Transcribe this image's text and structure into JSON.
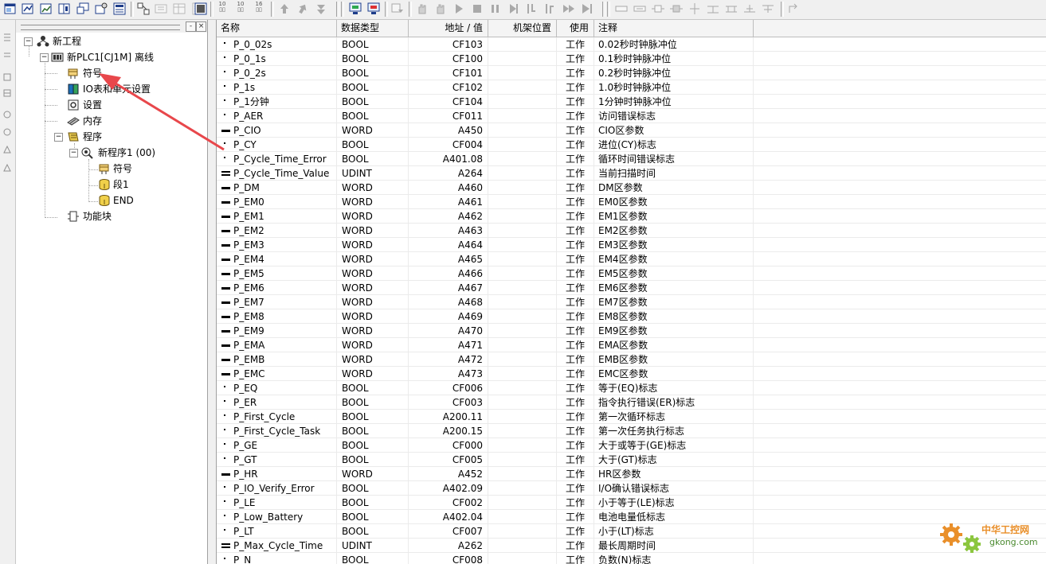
{
  "tree": {
    "root": "新工程",
    "plc": "新PLC1[CJ1M] 离线",
    "symbols": "符号",
    "io_table": "IO表和单元设置",
    "settings": "设置",
    "memory": "内存",
    "programs": "程序",
    "program1": "新程序1 (00)",
    "program_symbols": "符号",
    "section1": "段1",
    "end": "END",
    "function_blocks": "功能块"
  },
  "table": {
    "headers": {
      "name": "名称",
      "type": "数据类型",
      "address": "地址 / 值",
      "rack": "机架位置",
      "use": "使用",
      "comment": "注释"
    },
    "rows": [
      {
        "name": "P_0_02s",
        "type": "BOOL",
        "address": "CF103",
        "use": "工作",
        "comment": "0.02秒时钟脉冲位"
      },
      {
        "name": "P_0_1s",
        "type": "BOOL",
        "address": "CF100",
        "use": "工作",
        "comment": "0.1秒时钟脉冲位"
      },
      {
        "name": "P_0_2s",
        "type": "BOOL",
        "address": "CF101",
        "use": "工作",
        "comment": "0.2秒时钟脉冲位"
      },
      {
        "name": "P_1s",
        "type": "BOOL",
        "address": "CF102",
        "use": "工作",
        "comment": "1.0秒时钟脉冲位"
      },
      {
        "name": "P_1分钟",
        "type": "BOOL",
        "address": "CF104",
        "use": "工作",
        "comment": "1分钟时钟脉冲位"
      },
      {
        "name": "P_AER",
        "type": "BOOL",
        "address": "CF011",
        "use": "工作",
        "comment": "访问错误标志"
      },
      {
        "name": "P_CIO",
        "type": "WORD",
        "address": "A450",
        "use": "工作",
        "comment": "CIO区参数"
      },
      {
        "name": "P_CY",
        "type": "BOOL",
        "address": "CF004",
        "use": "工作",
        "comment": "进位(CY)标志"
      },
      {
        "name": "P_Cycle_Time_Error",
        "type": "BOOL",
        "address": "A401.08",
        "use": "工作",
        "comment": "循环时间错误标志"
      },
      {
        "name": "P_Cycle_Time_Value",
        "type": "UDINT",
        "address": "A264",
        "use": "工作",
        "comment": "当前扫描时间"
      },
      {
        "name": "P_DM",
        "type": "WORD",
        "address": "A460",
        "use": "工作",
        "comment": "DM区参数"
      },
      {
        "name": "P_EM0",
        "type": "WORD",
        "address": "A461",
        "use": "工作",
        "comment": "EM0区参数"
      },
      {
        "name": "P_EM1",
        "type": "WORD",
        "address": "A462",
        "use": "工作",
        "comment": "EM1区参数"
      },
      {
        "name": "P_EM2",
        "type": "WORD",
        "address": "A463",
        "use": "工作",
        "comment": "EM2区参数"
      },
      {
        "name": "P_EM3",
        "type": "WORD",
        "address": "A464",
        "use": "工作",
        "comment": "EM3区参数"
      },
      {
        "name": "P_EM4",
        "type": "WORD",
        "address": "A465",
        "use": "工作",
        "comment": "EM4区参数"
      },
      {
        "name": "P_EM5",
        "type": "WORD",
        "address": "A466",
        "use": "工作",
        "comment": "EM5区参数"
      },
      {
        "name": "P_EM6",
        "type": "WORD",
        "address": "A467",
        "use": "工作",
        "comment": "EM6区参数"
      },
      {
        "name": "P_EM7",
        "type": "WORD",
        "address": "A468",
        "use": "工作",
        "comment": "EM7区参数"
      },
      {
        "name": "P_EM8",
        "type": "WORD",
        "address": "A469",
        "use": "工作",
        "comment": "EM8区参数"
      },
      {
        "name": "P_EM9",
        "type": "WORD",
        "address": "A470",
        "use": "工作",
        "comment": "EM9区参数"
      },
      {
        "name": "P_EMA",
        "type": "WORD",
        "address": "A471",
        "use": "工作",
        "comment": "EMA区参数"
      },
      {
        "name": "P_EMB",
        "type": "WORD",
        "address": "A472",
        "use": "工作",
        "comment": "EMB区参数"
      },
      {
        "name": "P_EMC",
        "type": "WORD",
        "address": "A473",
        "use": "工作",
        "comment": "EMC区参数"
      },
      {
        "name": "P_EQ",
        "type": "BOOL",
        "address": "CF006",
        "use": "工作",
        "comment": "等于(EQ)标志"
      },
      {
        "name": "P_ER",
        "type": "BOOL",
        "address": "CF003",
        "use": "工作",
        "comment": "指令执行错误(ER)标志"
      },
      {
        "name": "P_First_Cycle",
        "type": "BOOL",
        "address": "A200.11",
        "use": "工作",
        "comment": "第一次循环标志"
      },
      {
        "name": "P_First_Cycle_Task",
        "type": "BOOL",
        "address": "A200.15",
        "use": "工作",
        "comment": "第一次任务执行标志"
      },
      {
        "name": "P_GE",
        "type": "BOOL",
        "address": "CF000",
        "use": "工作",
        "comment": "大于或等于(GE)标志"
      },
      {
        "name": "P_GT",
        "type": "BOOL",
        "address": "CF005",
        "use": "工作",
        "comment": "大于(GT)标志"
      },
      {
        "name": "P_HR",
        "type": "WORD",
        "address": "A452",
        "use": "工作",
        "comment": "HR区参数"
      },
      {
        "name": "P_IO_Verify_Error",
        "type": "BOOL",
        "address": "A402.09",
        "use": "工作",
        "comment": "I/O确认错误标志"
      },
      {
        "name": "P_LE",
        "type": "BOOL",
        "address": "CF002",
        "use": "工作",
        "comment": "小于等于(LE)标志"
      },
      {
        "name": "P_Low_Battery",
        "type": "BOOL",
        "address": "A402.04",
        "use": "工作",
        "comment": "电池电量低标志"
      },
      {
        "name": "P_LT",
        "type": "BOOL",
        "address": "CF007",
        "use": "工作",
        "comment": "小于(LT)标志"
      },
      {
        "name": "P_Max_Cycle_Time",
        "type": "UDINT",
        "address": "A262",
        "use": "工作",
        "comment": "最长周期时间"
      },
      {
        "name": "P_N",
        "type": "BOOL",
        "address": "CF008",
        "use": "工作",
        "comment": "负数(N)标志"
      }
    ]
  },
  "toolbar": {
    "counter_labels": [
      "10",
      "10",
      "16"
    ]
  },
  "watermark": {
    "title": "中华工控网",
    "domain": "gkong.com"
  },
  "colors": {
    "arrow": "#e8474b",
    "watermark_orange": "#e98f2a",
    "watermark_green": "#4a8a2f"
  }
}
